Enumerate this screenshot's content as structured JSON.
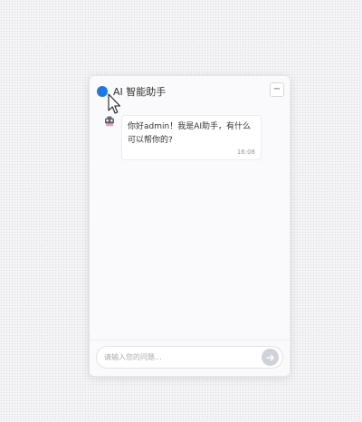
{
  "header": {
    "title": "AI 智能助手",
    "minimize_label": "−",
    "icon": "chat-bubble-icon"
  },
  "messages": [
    {
      "role": "assistant",
      "avatar": "robot-icon",
      "text": "你好admin！我是AI助手，有什么可以帮你的?",
      "time": "16:08"
    }
  ],
  "input": {
    "placeholder": "请输入您的问题...",
    "value": ""
  },
  "send_button": {
    "icon": "send-arrow-icon"
  },
  "colors": {
    "accent": "#1e78e6",
    "send_button": "#cfd2d8"
  }
}
